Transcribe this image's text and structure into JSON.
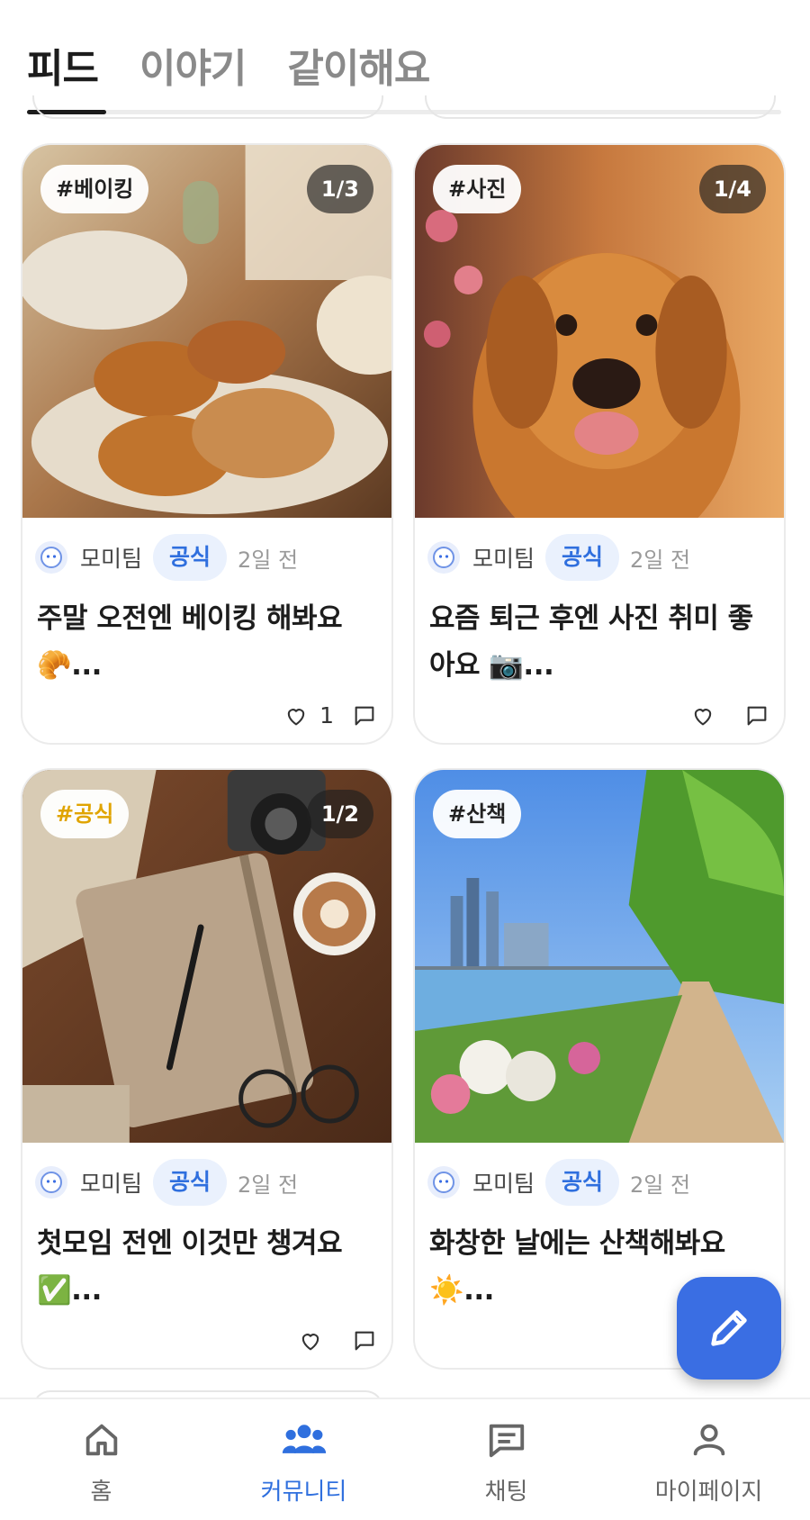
{
  "tabs": [
    {
      "label": "피드",
      "active": true
    },
    {
      "label": "이야기",
      "active": false
    },
    {
      "label": "같이해요",
      "active": false
    }
  ],
  "posts": [
    {
      "tag": "#베이킹",
      "tag_color": "#222222",
      "image_count": "1/3",
      "author": "모미팀",
      "badge": "공식",
      "time": "2일 전",
      "title": "주말 오전엔 베이킹 해봐요 🥐...",
      "likes": "1",
      "image_icon": "croissant-photo"
    },
    {
      "tag": "#사진",
      "tag_color": "#222222",
      "image_count": "1/4",
      "author": "모미팀",
      "badge": "공식",
      "time": "2일 전",
      "title": "요즘 퇴근 후엔 사진 취미 좋아요 📷...",
      "likes": "",
      "image_icon": "dog-photo"
    },
    {
      "tag": "#공식",
      "tag_color": "#e0a400",
      "image_count": "1/2",
      "author": "모미팀",
      "badge": "공식",
      "time": "2일 전",
      "title": "첫모임 전엔 이것만 챙겨요 ✅...",
      "likes": "",
      "image_icon": "notebook-photo"
    },
    {
      "tag": "#산책",
      "tag_color": "#222222",
      "image_count": "",
      "author": "모미팀",
      "badge": "공식",
      "time": "2일 전",
      "title": "화창한 날에는 산책해봐요 ☀️...",
      "likes": "",
      "image_icon": "riverside-photo"
    }
  ],
  "fab": {
    "icon": "pencil-icon"
  },
  "bottom_nav": [
    {
      "label": "홈",
      "icon": "home-icon",
      "active": false
    },
    {
      "label": "커뮤니티",
      "icon": "community-icon",
      "active": true
    },
    {
      "label": "채팅",
      "icon": "chat-icon",
      "active": false
    },
    {
      "label": "마이페이지",
      "icon": "person-icon",
      "active": false
    }
  ],
  "colors": {
    "accent": "#3a6ee3",
    "active_nav": "#2f6fde",
    "badge_bg": "#eaf1fd"
  }
}
